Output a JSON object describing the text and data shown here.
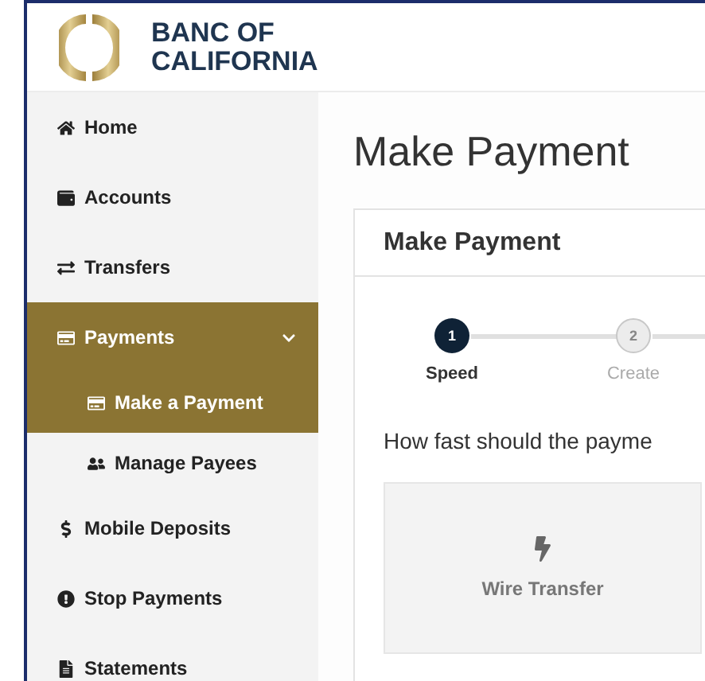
{
  "brand": {
    "name": "BANC OF CALIFORNIA"
  },
  "sidebar": {
    "items": [
      {
        "label": "Home",
        "selected": false
      },
      {
        "label": "Accounts",
        "selected": false
      },
      {
        "label": "Transfers",
        "selected": false
      },
      {
        "label": "Payments",
        "selected": true,
        "expanded": true,
        "children": [
          {
            "label": "Make a Payment",
            "selected": true
          },
          {
            "label": "Manage Payees",
            "selected": false
          }
        ]
      },
      {
        "label": "Mobile Deposits",
        "selected": false
      },
      {
        "label": "Stop Payments",
        "selected": false
      },
      {
        "label": "Statements",
        "selected": false
      }
    ]
  },
  "page": {
    "title": "Make Payment"
  },
  "card": {
    "title": "Make Payment",
    "steps": [
      {
        "number": "1",
        "label": "Speed",
        "selected": true
      },
      {
        "number": "2",
        "label": "Create",
        "selected": false
      }
    ],
    "question": "How fast should the payme",
    "options": [
      {
        "label": "Wire Transfer",
        "selected": false
      }
    ]
  }
}
